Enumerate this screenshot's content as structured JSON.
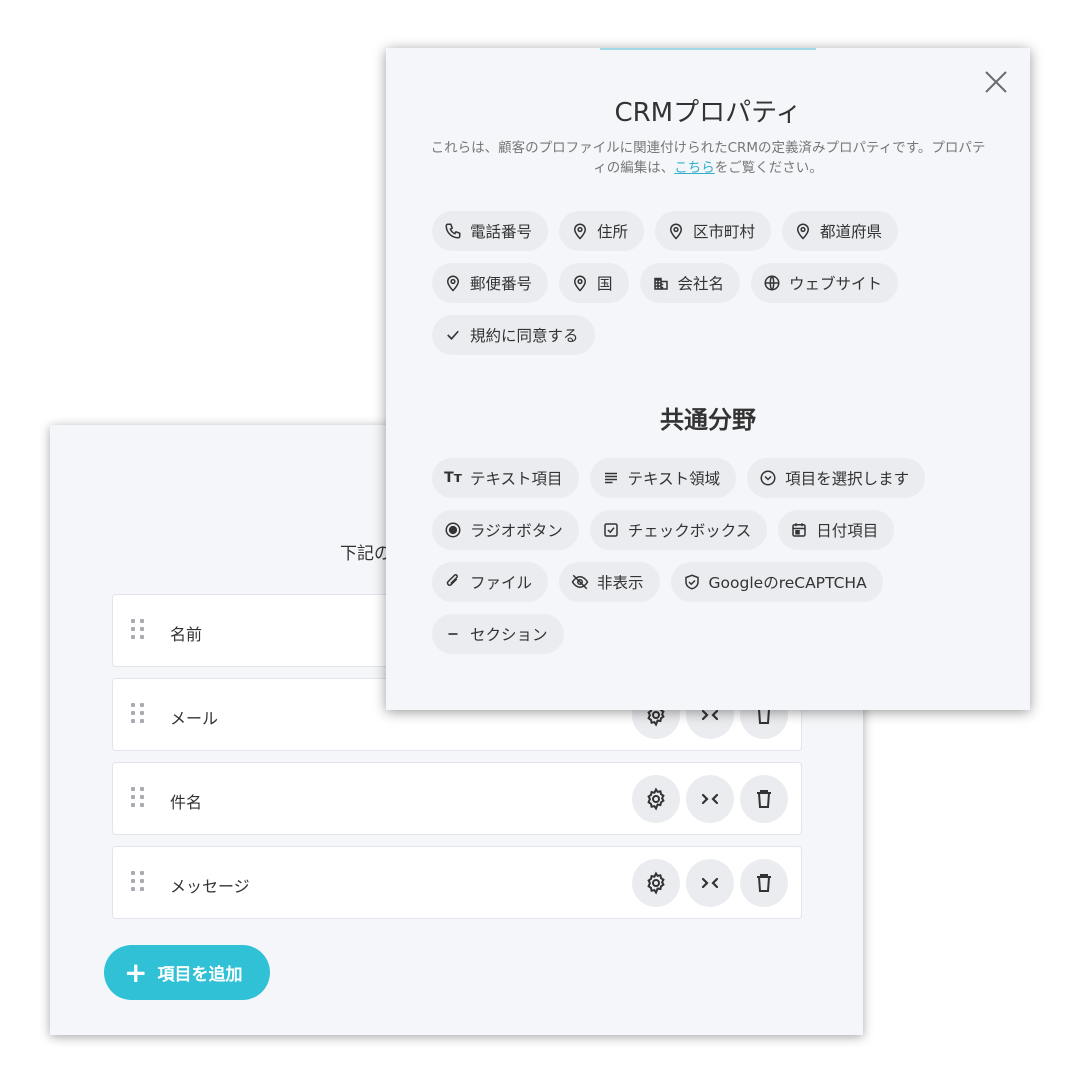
{
  "form_builder": {
    "instruction_partial": "下記の",
    "fields": [
      {
        "label": "名前"
      },
      {
        "label": "メール"
      },
      {
        "label": "件名"
      },
      {
        "label": "メッセージ"
      }
    ],
    "add_button_label": "項目を追加",
    "accent_color": "#30c1d7"
  },
  "crm_modal": {
    "title": "CRMプロパティ",
    "description_before": "これらは、顧客のプロファイルに関連付けられたCRMの定義済みプロパティです。プロパティの編集は、",
    "description_link": "こちら",
    "description_after": "をご覧ください。",
    "crm_properties": [
      {
        "label": "電話番号",
        "icon": "phone-icon"
      },
      {
        "label": "住所",
        "icon": "location-pin-icon"
      },
      {
        "label": "区市町村",
        "icon": "location-pin-icon"
      },
      {
        "label": "都道府県",
        "icon": "location-pin-icon"
      },
      {
        "label": "郵便番号",
        "icon": "location-pin-icon"
      },
      {
        "label": "国",
        "icon": "location-pin-icon"
      },
      {
        "label": "会社名",
        "icon": "building-icon"
      },
      {
        "label": "ウェブサイト",
        "icon": "globe-icon"
      },
      {
        "label": "規約に同意する",
        "icon": "checkmark-icon"
      }
    ],
    "common_title": "共通分野",
    "common_fields": [
      {
        "label": "テキスト項目",
        "icon": "text-field-icon"
      },
      {
        "label": "テキスト領域",
        "icon": "text-area-icon"
      },
      {
        "label": "項目を選択します",
        "icon": "dropdown-icon"
      },
      {
        "label": "ラジオボタン",
        "icon": "radio-icon"
      },
      {
        "label": "チェックボックス",
        "icon": "checkbox-icon"
      },
      {
        "label": "日付項目",
        "icon": "calendar-icon"
      },
      {
        "label": "ファイル",
        "icon": "paperclip-icon"
      },
      {
        "label": "非表示",
        "icon": "eye-off-icon"
      },
      {
        "label": "GoogleのreCAPTCHA",
        "icon": "shield-check-icon"
      },
      {
        "label": "セクション",
        "icon": "minus-icon"
      }
    ]
  }
}
